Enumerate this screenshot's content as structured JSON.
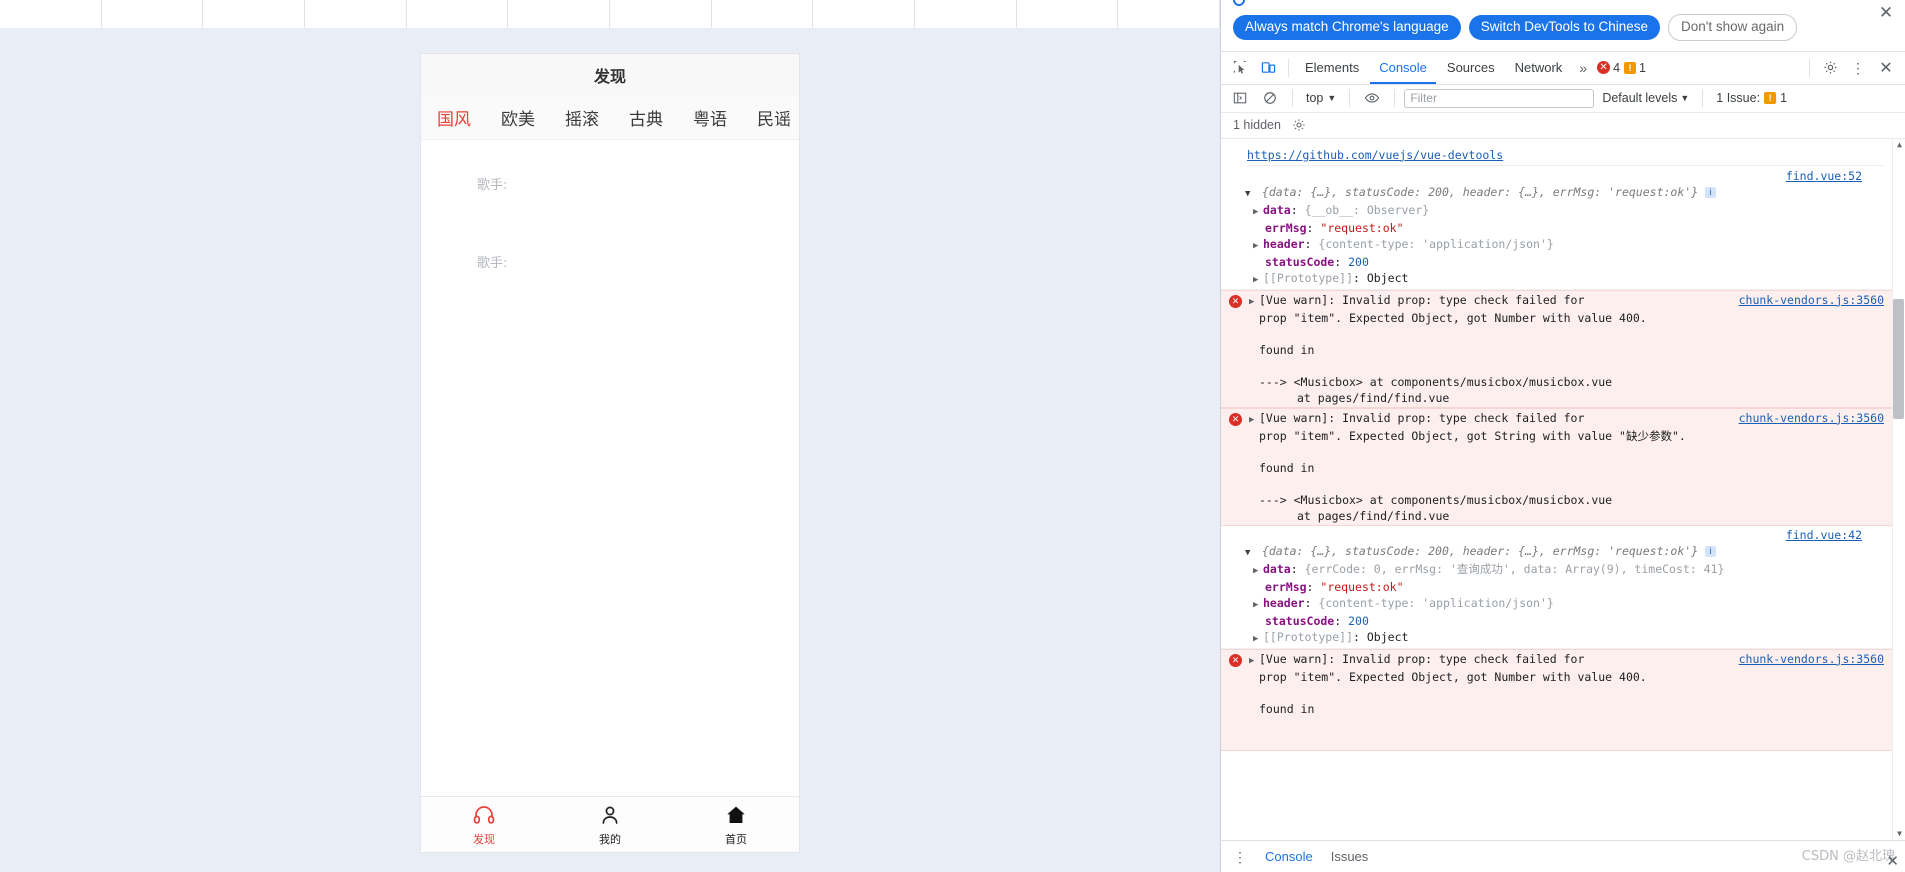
{
  "browser_page": {
    "grid_columns": 12
  },
  "phone": {
    "header_title": "发现",
    "tabs": [
      {
        "label": "国风",
        "active": true
      },
      {
        "label": "欧美",
        "active": false
      },
      {
        "label": "摇滚",
        "active": false
      },
      {
        "label": "古典",
        "active": false
      },
      {
        "label": "粤语",
        "active": false
      },
      {
        "label": "民谣",
        "active": false
      }
    ],
    "songs": [
      {
        "artist_label": "歌手:"
      },
      {
        "artist_label": "歌手:"
      }
    ],
    "tabbar": [
      {
        "label": "发现",
        "icon": "headphones-icon",
        "active": true
      },
      {
        "label": "我的",
        "icon": "user-icon",
        "active": false
      },
      {
        "label": "首页",
        "icon": "home-icon",
        "active": false
      }
    ]
  },
  "devtools": {
    "language_banner": {
      "always_match": "Always match Chrome's language",
      "switch_chinese": "Switch DevTools to Chinese",
      "dont_show": "Don't show again",
      "close_icon": "close-icon"
    },
    "tabstrip": {
      "inspect_icon": "inspect-element-icon",
      "device_icon": "device-toolbar-icon",
      "tabs": [
        {
          "label": "Elements",
          "active": false
        },
        {
          "label": "Console",
          "active": true
        },
        {
          "label": "Sources",
          "active": false
        },
        {
          "label": "Network",
          "active": false
        }
      ],
      "more_tabs_icon": "chevron-double-right-icon",
      "error_count": "4",
      "warning_count": "1",
      "settings_icon": "gear-icon",
      "more_icon": "kebab-menu-icon",
      "close_icon": "close-icon"
    },
    "console_toolbar": {
      "sidebar_icon": "console-sidebar-icon",
      "clear_icon": "clear-console-icon",
      "context": "top",
      "eye_icon": "live-expression-icon",
      "filter_placeholder": "Filter",
      "filter_value": "",
      "levels": "Default levels",
      "issues_label": "1 Issue:",
      "issues_count": "1"
    },
    "hidden_row": {
      "text": "1 hidden",
      "settings_icon": "gear-icon"
    },
    "messages": [
      {
        "type": "plain",
        "devtools_url": "https://github.com/vuejs/vue-devtools",
        "source": "find.vue:52",
        "summary_prefix": "{data: ",
        "summary": "{data: {…}, statusCode: 200, header: {…}, errMsg: 'request:ok'}",
        "rows": [
          {
            "key": "data",
            "value": "{__ob__: Observer}",
            "expandable": true
          },
          {
            "key": "errMsg",
            "value": "\"request:ok\"",
            "expandable": false
          },
          {
            "key": "header",
            "value": "{content-type: 'application/json'}",
            "expandable": true
          },
          {
            "key": "statusCode",
            "value": "200",
            "expandable": false
          },
          {
            "key": "[[Prototype]]",
            "value": "Object",
            "expandable": true
          }
        ]
      },
      {
        "type": "error",
        "source": "chunk-vendors.js:3560",
        "line1": "[Vue warn]: Invalid prop: type check failed for",
        "line2": "prop \"item\". Expected Object, got Number with value 400.",
        "line3": "found in",
        "line4": "---> <Musicbox> at components/musicbox/musicbox.vue",
        "line5": "at pages/find/find.vue"
      },
      {
        "type": "error",
        "source": "chunk-vendors.js:3560",
        "line1": "[Vue warn]: Invalid prop: type check failed for",
        "line2": "prop \"item\". Expected Object, got String with value \"缺少参数\".",
        "line3": "found in",
        "line4": "---> <Musicbox> at components/musicbox/musicbox.vue",
        "line5": "at pages/find/find.vue"
      },
      {
        "type": "plain",
        "source": "find.vue:42",
        "summary": "{data: {…}, statusCode: 200, header: {…}, errMsg: 'request:ok'}",
        "rows": [
          {
            "key": "data",
            "value": "{errCode: 0, errMsg: '查询成功', data: Array(9), timeCost: 41}",
            "expandable": true
          },
          {
            "key": "errMsg",
            "value": "\"request:ok\"",
            "expandable": false
          },
          {
            "key": "header",
            "value": "{content-type: 'application/json'}",
            "expandable": true
          },
          {
            "key": "statusCode",
            "value": "200",
            "expandable": false
          },
          {
            "key": "[[Prototype]]",
            "value": "Object",
            "expandable": true
          }
        ]
      },
      {
        "type": "error",
        "source": "chunk-vendors.js:3560",
        "line1": "[Vue warn]: Invalid prop: type check failed for",
        "line2": "prop \"item\". Expected Object, got Number with value 400.",
        "line3": "found in",
        "line4": "",
        "line5": ""
      }
    ],
    "drawer": {
      "more_icon": "kebab-menu-icon",
      "tabs": [
        {
          "label": "Console",
          "active": true
        },
        {
          "label": "Issues",
          "active": false
        }
      ],
      "close_icon": "close-icon"
    },
    "watermark": "CSDN @赵北瑰"
  },
  "colors": {
    "accent_blue": "#1a73e8",
    "error_red": "#d93025",
    "warn_orange": "#f29900",
    "app_red": "#e8403a",
    "error_bg": "#fcefee"
  }
}
